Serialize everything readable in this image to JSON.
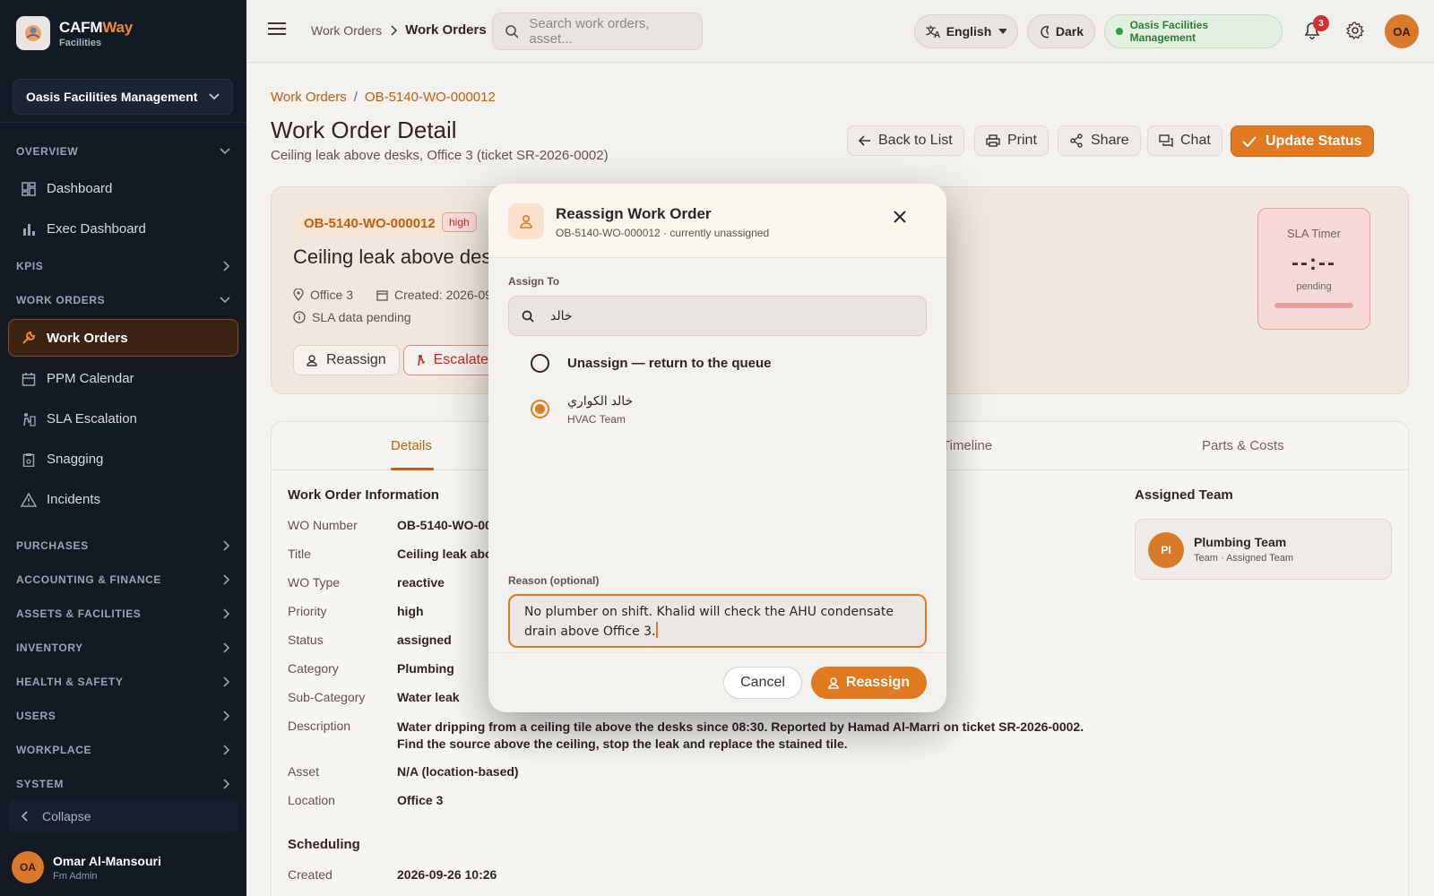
{
  "colors": {
    "accent": "#e07a20",
    "sidebar_bg": "#131a24",
    "danger": "#c62828",
    "success": "#2e7d32"
  },
  "brand": {
    "name_part1": "CAFM",
    "name_part2": "Way",
    "subtitle": "Facilities"
  },
  "sidebar": {
    "org_selector": "Oasis Facilities Management",
    "sections": {
      "overview": "OVERVIEW",
      "kpis": "KPIS",
      "work_orders": "WORK ORDERS",
      "purchases": "PURCHASES",
      "accounting": "ACCOUNTING & FINANCE",
      "assets": "ASSETS & FACILITIES",
      "inventory": "INVENTORY",
      "health": "HEALTH & SAFETY",
      "users": "USERS",
      "workplace": "WORKPLACE",
      "system": "SYSTEM"
    },
    "items": {
      "dashboard": "Dashboard",
      "exec_dashboard": "Exec Dashboard",
      "work_orders": "Work Orders",
      "ppm_calendar": "PPM Calendar",
      "sla_escalation": "SLA Escalation",
      "snagging": "Snagging",
      "incidents": "Incidents"
    },
    "collapse": "Collapse",
    "user": {
      "initials": "OA",
      "name": "Omar Al-Mansouri",
      "role": "Fm Admin"
    }
  },
  "topbar": {
    "breadcrumb_parent": "Work Orders",
    "breadcrumb_current": "Work Orders",
    "search_placeholder": "Search work orders, asset...",
    "language": "English",
    "theme": "Dark",
    "org_status": "Oasis Facilities Management",
    "notification_count": "3",
    "avatar_initials": "OA"
  },
  "page": {
    "breadcrumb": [
      "Work Orders",
      "OB-5140-WO-000012"
    ],
    "title": "Work Order Detail",
    "subtitle": "Ceiling leak above desks, Office 3 (ticket SR-2026-0002)",
    "actions": {
      "back": "Back to List",
      "print": "Print",
      "share": "Share",
      "chat": "Chat",
      "update": "Update Status"
    }
  },
  "summary": {
    "wo_number": "OB-5140-WO-000012",
    "priority": "high",
    "title": "Ceiling leak above desks",
    "location": "Office 3",
    "created": "Created: 2026-09",
    "sla_note": "SLA data pending",
    "buttons": {
      "reassign": "Reassign",
      "escalate": "Escalate"
    },
    "sla_timer": {
      "title": "SLA Timer",
      "value": "--:--",
      "status": "pending"
    }
  },
  "tabs": [
    "Details",
    "Timeline",
    "Parts & Costs"
  ],
  "details": {
    "section_title": "Work Order Information",
    "rows": [
      {
        "label": "WO Number",
        "value": "OB-5140-WO-000"
      },
      {
        "label": "Title",
        "value": "Ceiling leak abov"
      },
      {
        "label": "WO Type",
        "value": "reactive"
      },
      {
        "label": "Priority",
        "value": "high"
      },
      {
        "label": "Status",
        "value": "assigned"
      },
      {
        "label": "Category",
        "value": "Plumbing"
      },
      {
        "label": "Sub-Category",
        "value": "Water leak"
      },
      {
        "label": "Description",
        "value": "Water dripping from a ceiling tile above the desks since 08:30. Reported by Hamad Al-Marri on ticket SR-2026-0002. Find the source above the ceiling, stop the leak and replace the stained tile."
      },
      {
        "label": "Asset",
        "value": "N/A (location-based)"
      },
      {
        "label": "Location",
        "value": "Office 3"
      }
    ],
    "scheduling_title": "Scheduling",
    "created_label": "Created",
    "created_value": "2026-09-26 10:26",
    "assigned_team_title": "Assigned Team",
    "team": {
      "initials": "PI",
      "name": "Plumbing Team",
      "sub": "Team · Assigned Team"
    }
  },
  "modal": {
    "title": "Reassign Work Order",
    "subtitle": "OB-5140-WO-000012 · currently unassigned",
    "assign_label": "Assign To",
    "search_value": "خالد",
    "options": [
      {
        "label": "Unassign — return to the queue",
        "selected": false
      },
      {
        "label": "خالد الكواري",
        "sub": "HVAC Team",
        "selected": true
      }
    ],
    "reason_label": "Reason (optional)",
    "reason_value": "No plumber on shift. Khalid will check the AHU condensate drain above Office 3.",
    "cancel": "Cancel",
    "confirm": "Reassign"
  }
}
